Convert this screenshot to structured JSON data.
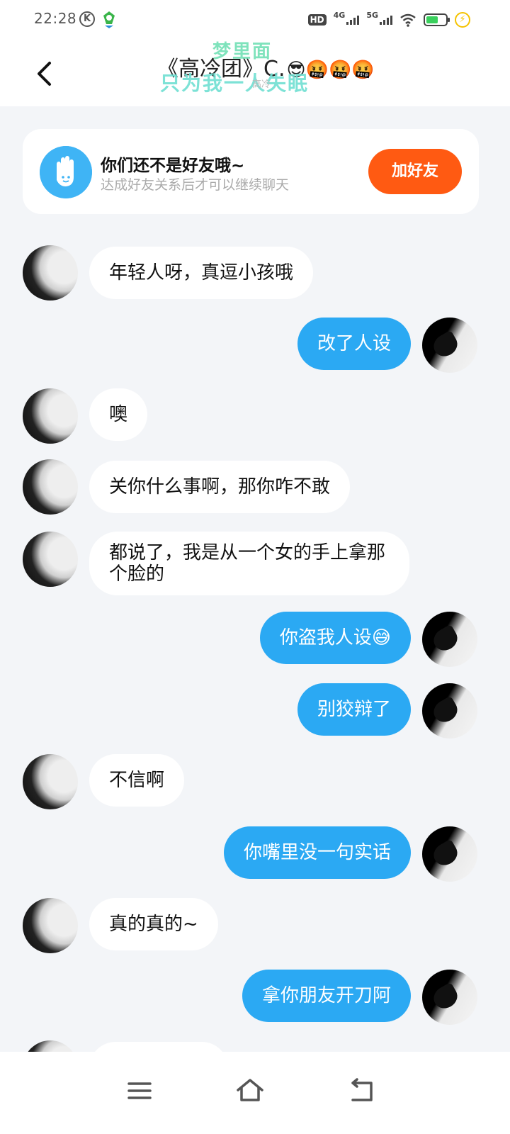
{
  "status_bar": {
    "time": "22:28",
    "hd_label": "HD",
    "net1": "4G",
    "net2": "5G",
    "battery_level": 0.6
  },
  "header": {
    "title": "《高冷团》C.",
    "title_emojis": "😎🤬🤬🤬",
    "overlay_line1": "梦里面",
    "overlay_line2": "只为我一人失眠",
    "subtitle": "高冷"
  },
  "friend_card": {
    "title": "你们还不是好友哦~",
    "subtitle": "达成好友关系后才可以继续聊天",
    "button": "加好友"
  },
  "messages": [
    {
      "side": "left",
      "text": "年轻人呀，真逗小孩哦"
    },
    {
      "side": "right",
      "text": "改了人设"
    },
    {
      "side": "left",
      "text": "噢"
    },
    {
      "side": "left",
      "text": "关你什么事啊，那你咋不敢"
    },
    {
      "side": "left",
      "text": "都说了，我是从一个女的手上拿那个脸的"
    },
    {
      "side": "right",
      "text": "你盗我人设",
      "emoji": "😅"
    },
    {
      "side": "right",
      "text": "别狡辩了"
    },
    {
      "side": "left",
      "text": "不信啊"
    },
    {
      "side": "right",
      "text": "你嘴里没一句实话"
    },
    {
      "side": "left",
      "text": "真的真的~"
    },
    {
      "side": "right",
      "text": "拿你朋友开刀阿"
    }
  ],
  "nav_bar": {
    "icons": [
      "menu-icon",
      "home-icon",
      "back-icon"
    ]
  }
}
